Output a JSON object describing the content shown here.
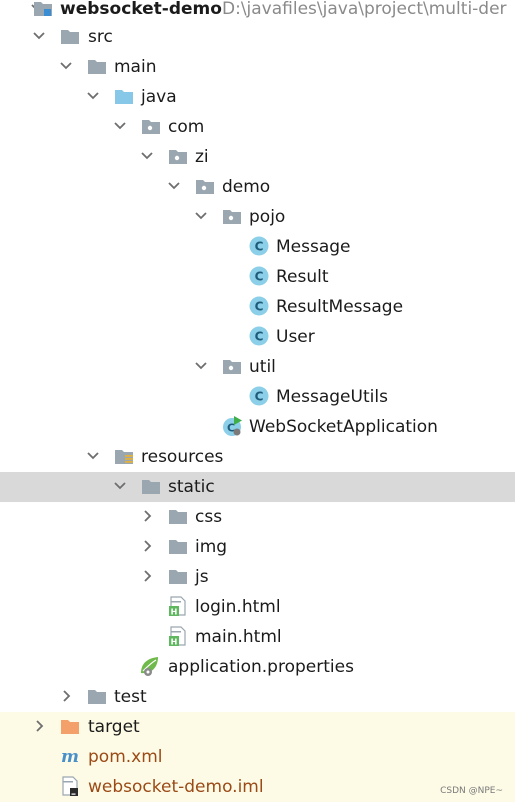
{
  "project": {
    "name": "websocket-demo",
    "path": "D:\\javafiles\\java\\project\\multi-der"
  },
  "tree": {
    "src": "src",
    "main": "main",
    "java": "java",
    "com": "com",
    "zi": "zi",
    "demo": "demo",
    "pojo": "pojo",
    "message": "Message",
    "result": "Result",
    "result_message": "ResultMessage",
    "user": "User",
    "util": "util",
    "message_utils": "MessageUtils",
    "websocket_application": "WebSocketApplication",
    "resources": "resources",
    "static": "static",
    "css": "css",
    "img": "img",
    "js": "js",
    "login_html": "login.html",
    "main_html": "main.html",
    "application_properties": "application.properties",
    "test": "test",
    "target": "target",
    "pom_xml": "pom.xml",
    "iml": "websocket-demo.iml"
  },
  "watermark": "CSDN @NPE~",
  "colors": {
    "folder": "#9aa7b0",
    "source_folder": "#87c7e8",
    "excluded_folder": "#f3a06a",
    "class_icon": "#8ccfe8",
    "class_letter": "#1e5b79",
    "selected_row": "#d9d9d9",
    "highlight_row": "#fdfbe6",
    "excluded_text": "#9b4a16"
  },
  "icons": {
    "folder": "folder-icon",
    "source_folder": "source-folder-icon",
    "package": "package-icon",
    "class": "class-icon",
    "spring_boot_app": "spring-boot-app-icon",
    "resources_folder": "resources-folder-icon",
    "html": "html-file-icon",
    "properties": "spring-properties-icon",
    "maven": "maven-icon",
    "iml": "iml-file-icon"
  }
}
